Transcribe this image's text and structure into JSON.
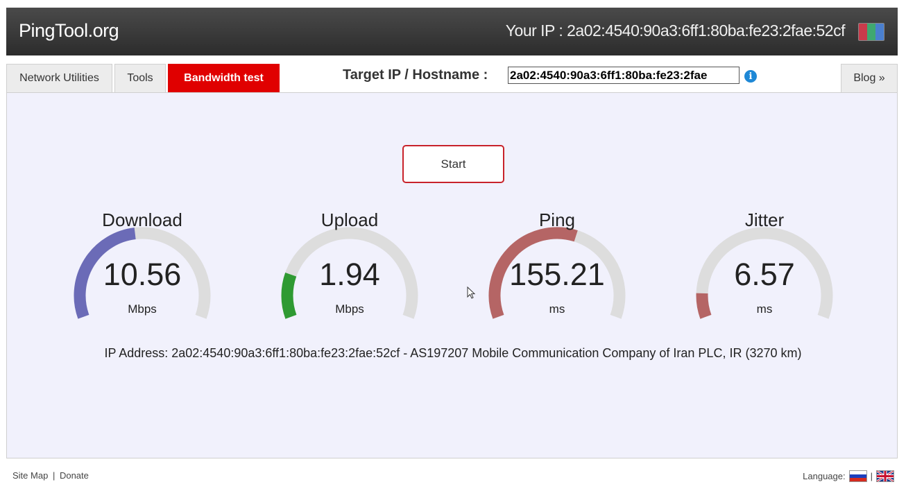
{
  "header": {
    "logo": "PingTool.org",
    "your_ip": "Your IP : 2a02:4540:90a3:6ff1:80ba:fe23:2fae:52cf",
    "flag_icon": "flag-icon"
  },
  "tabs": [
    {
      "label": "Network Utilities",
      "active": false
    },
    {
      "label": "Tools",
      "active": false
    },
    {
      "label": "Bandwidth test",
      "active": true
    }
  ],
  "target": {
    "label": "Target IP / Hostname :",
    "value": "2a02:4540:90a3:6ff1:80ba:fe23:2fae",
    "info_icon": "info-icon"
  },
  "blog_tab": "Blog »",
  "start_button": "Start",
  "gauges": [
    {
      "title": "Download",
      "value": "10.56",
      "unit": "Mbps",
      "fill_fraction": 0.47,
      "color": "#6b6bb7"
    },
    {
      "title": "Upload",
      "value": "1.94",
      "unit": "Mbps",
      "fill_fraction": 0.18,
      "color": "#2f9a32"
    },
    {
      "title": "Ping",
      "value": "155.21",
      "unit": "ms",
      "fill_fraction": 0.58,
      "color": "#b56565"
    },
    {
      "title": "Jitter",
      "value": "6.57",
      "unit": "ms",
      "fill_fraction": 0.1,
      "color": "#b56565"
    }
  ],
  "ip_info": "IP Address: 2a02:4540:90a3:6ff1:80ba:fe23:2fae:52cf - AS197207 Mobile Communication Company of Iran PLC, IR (3270 km)",
  "footer": {
    "site_map": "Site Map",
    "separator": "|",
    "donate": "Donate",
    "language_label": "Language:"
  },
  "colors": {
    "accent_red": "#e00000",
    "track_gray": "#dddddd",
    "panel_bg": "#f1f1fc"
  }
}
